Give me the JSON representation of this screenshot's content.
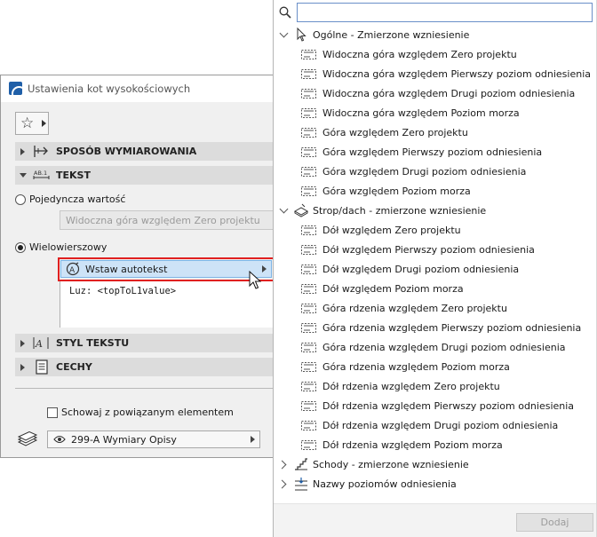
{
  "dialog": {
    "title": "Ustawienia kot wysokościowych",
    "sections": {
      "sposob": "SPOSÓB WYMIAROWANIA",
      "tekst": "TEKST",
      "styl": "STYL TEKSTU",
      "cechy": "CECHY"
    },
    "single_value_label": "Pojedyncza wartość",
    "single_value_field": "Widoczna góra względem Zero projektu",
    "multiline_label": "Wielowierszowy",
    "insert_autotext": "Wstaw autotekst",
    "text_content": "Luz: <topToL1value>",
    "hide_label": "Schowaj z powiązanym elementem",
    "layer": "299-A Wymiary Opisy"
  },
  "popup": {
    "search_value": "",
    "categories": [
      {
        "label": "Ogólne - Zmierzone wzniesienie",
        "expanded": true,
        "icon": "cursor-arrow-icon"
      },
      {
        "label": "Strop/dach - zmierzone wzniesienie",
        "expanded": true,
        "icon": "slab-icon"
      },
      {
        "label": "Schody - zmierzone wzniesienie",
        "expanded": false,
        "icon": "stair-icon"
      },
      {
        "label": "Nazwy poziomów odniesienia",
        "expanded": false,
        "icon": "reference-level-icon"
      }
    ],
    "items": [
      "Widoczna góra względem Zero projektu",
      "Widoczna góra względem Pierwszy poziom odniesienia",
      "Widoczna góra względem Drugi poziom odniesienia",
      "Widoczna góra względem Poziom morza",
      "Góra względem Zero projektu",
      "Góra względem Pierwszy poziom odniesienia",
      "Góra względem Drugi poziom odniesienia",
      "Góra względem Poziom morza",
      "Dół względem Zero projektu",
      "Dół względem Pierwszy poziom odniesienia",
      "Dół względem Drugi poziom odniesienia",
      "Dół względem Poziom morza",
      "Góra rdzenia względem Zero projektu",
      "Góra rdzenia względem Pierwszy poziom odniesienia",
      "Góra rdzenia względem Drugi poziom odniesienia",
      "Góra rdzenia względem Poziom morza",
      "Dół rdzenia względem Zero projektu",
      "Dół rdzenia względem Pierwszy poziom odniesienia",
      "Dół rdzenia względem Drugi poziom odniesienia",
      "Dół rdzenia względem Poziom morza"
    ],
    "add_button": "Dodaj"
  },
  "colors": {
    "highlight_border": "#e02020",
    "selected_fill": "#cde3f7",
    "selected_border": "#7eb4e5",
    "section_bg": "#dcdcdc"
  }
}
